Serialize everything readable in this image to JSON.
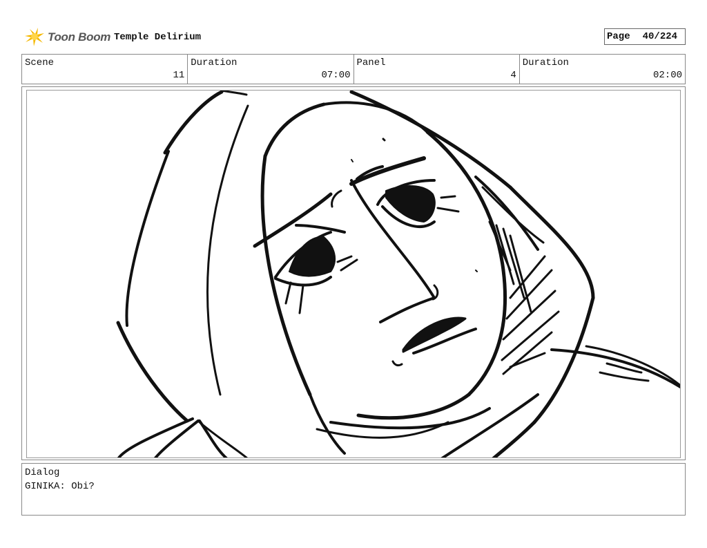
{
  "header": {
    "logo_text": "Toon Boom",
    "logo_icon": "star-burst-icon",
    "project_title": "Temple Delirium",
    "page_label": "Page",
    "page_value": "40/224"
  },
  "info": {
    "scene_label": "Scene",
    "scene_value": "11",
    "scene_duration_label": "Duration",
    "scene_duration_value": "07:00",
    "panel_label": "Panel",
    "panel_value": "4",
    "panel_duration_label": "Duration",
    "panel_duration_value": "02:00"
  },
  "dialog": {
    "label": "Dialog",
    "text": "GINIKA: Obi?"
  },
  "colors": {
    "logo_yellow": "#f5b800",
    "logo_text": "#555555",
    "border": "#888888",
    "ink": "#111111"
  }
}
